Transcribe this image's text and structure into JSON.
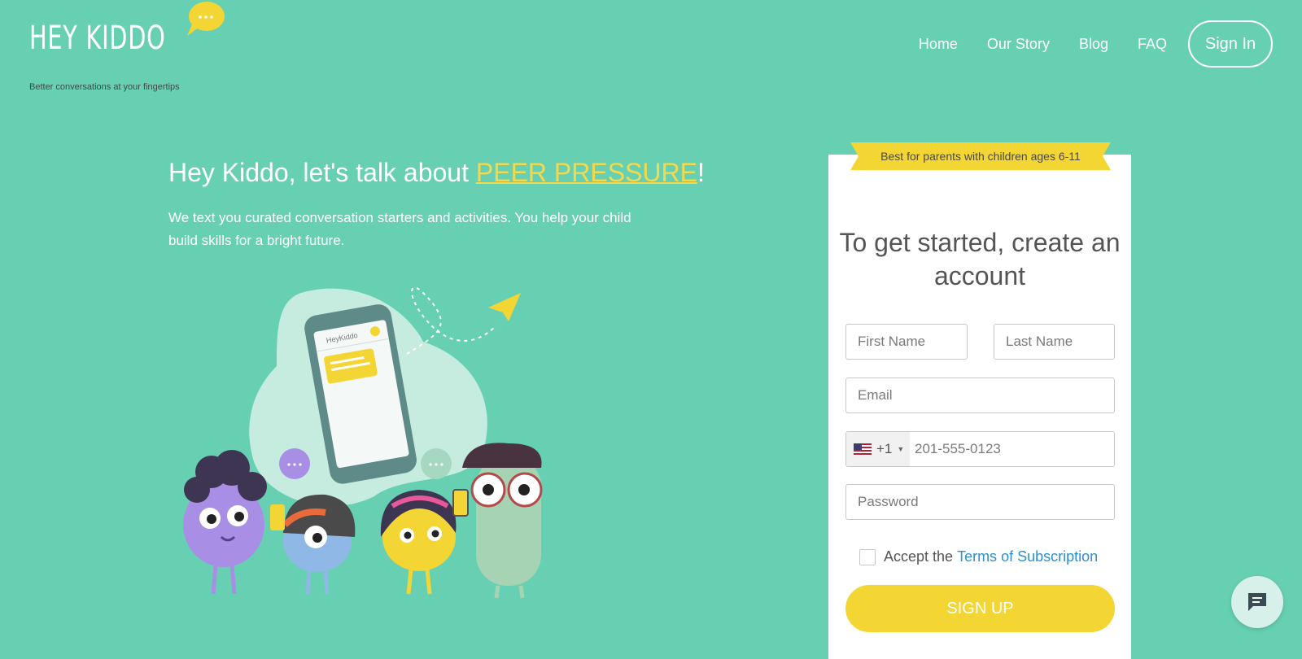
{
  "brand": {
    "logo_text": "HEY KIDDO",
    "tagline": "Better conversations at your fingertips"
  },
  "nav": {
    "items": [
      {
        "label": "Home"
      },
      {
        "label": "Our Story"
      },
      {
        "label": "Blog"
      },
      {
        "label": "FAQ"
      }
    ],
    "signin_label": "Sign In"
  },
  "hero": {
    "title_prefix": "Hey Kiddo, let's talk about ",
    "title_highlight": "PEER PRESSURE",
    "title_suffix": "!",
    "subtitle": "We text you curated conversation starters and activities. You help your child build skills for a bright future.",
    "phone_app_name": "HeyKiddo"
  },
  "signup": {
    "ribbon": "Best for parents with children ages 6-11",
    "title": "To get started, create an account",
    "first_name_placeholder": "First Name",
    "last_name_placeholder": "Last Name",
    "email_placeholder": "Email",
    "country_code": "+1",
    "phone_placeholder": "201-555-0123",
    "password_placeholder": "Password",
    "terms_prefix": "Accept the",
    "terms_link": "Terms of Subscription",
    "submit_label": "SIGN UP"
  },
  "colors": {
    "background": "#68d0b2",
    "accent_yellow": "#f3d534",
    "highlight_yellow": "#f3d94b",
    "link_blue": "#2d8fd0"
  },
  "icons": {
    "chat_widget": "chat-icon",
    "flag": "us-flag-icon",
    "logo_bubble": "speech-bubble-icon"
  }
}
